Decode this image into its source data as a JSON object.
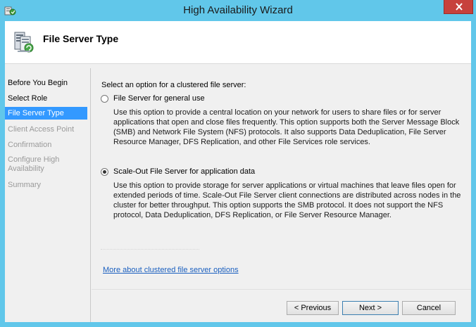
{
  "window": {
    "title": "High Availability Wizard"
  },
  "header": {
    "title": "File Server Type"
  },
  "nav": {
    "items": [
      {
        "label": "Before You Begin",
        "state": "done"
      },
      {
        "label": "Select Role",
        "state": "done"
      },
      {
        "label": "File Server Type",
        "state": "selected"
      },
      {
        "label": "Client Access Point",
        "state": "disabled"
      },
      {
        "label": "Confirmation",
        "state": "disabled"
      },
      {
        "label": "Configure High Availability",
        "state": "disabled"
      },
      {
        "label": "Summary",
        "state": "disabled"
      }
    ]
  },
  "main": {
    "prompt": "Select an option for a clustered file server:",
    "options": [
      {
        "label": "File Server for general use",
        "selected": false,
        "description": "Use this option to provide a central location on your network for users to share files or for server applications that open and close files frequently. This option supports both the Server Message Block (SMB) and Network File System (NFS) protocols. It also supports Data Deduplication, File Server Resource Manager, DFS Replication, and other File Services role services."
      },
      {
        "label": "Scale-Out File Server for application data",
        "selected": true,
        "description": "Use this option to provide storage for server applications or virtual machines that leave files open for extended periods of time. Scale-Out File Server client connections are distributed across nodes in the cluster for better throughput. This option supports the SMB protocol. It does not support the NFS protocol, Data Deduplication, DFS Replication, or File Server Resource Manager."
      }
    ],
    "link": "More about clustered file server options"
  },
  "buttons": {
    "previous": "< Previous",
    "next": "Next >",
    "cancel": "Cancel"
  },
  "icons": {
    "app": "wizard-app-icon",
    "header": "file-server-cluster-icon",
    "close": "close-icon"
  },
  "colors": {
    "frame": "#61c7ea",
    "selection": "#3399ff",
    "close": "#c7413c",
    "link": "#1a5fbf"
  }
}
